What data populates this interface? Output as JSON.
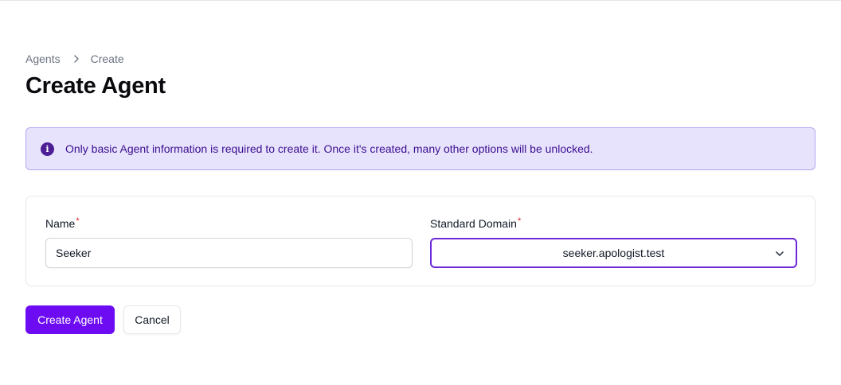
{
  "breadcrumb": {
    "items": [
      "Agents",
      "Create"
    ]
  },
  "page": {
    "title": "Create Agent"
  },
  "alert": {
    "icon": "info-icon",
    "text": "Only basic Agent information is required to create it. Once it's created, many other options will be unlocked."
  },
  "form": {
    "name": {
      "label": "Name",
      "required_mark": "*",
      "value": "Seeker"
    },
    "domain": {
      "label": "Standard Domain",
      "required_mark": "*",
      "selected": "seeker.apologist.test"
    }
  },
  "actions": {
    "submit_label": "Create Agent",
    "cancel_label": "Cancel"
  },
  "colors": {
    "primary": "#6d0cf2",
    "alert_bg": "#e7e3fc",
    "alert_text": "#3b0d8f",
    "required": "#dc2626"
  }
}
